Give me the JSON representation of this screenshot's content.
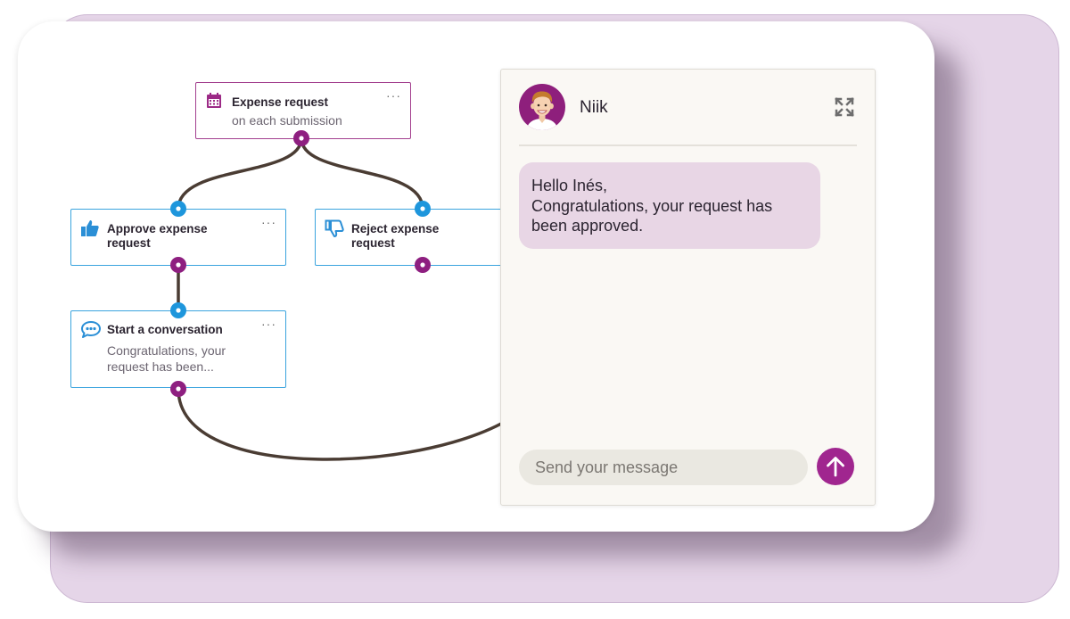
{
  "colors": {
    "accent": "#a0268f",
    "connector": "#4a3c33",
    "action_border": "#3aa4de",
    "trigger_border": "#a3408f",
    "bubble": "#e8d6e5",
    "panel": "#faf8f4"
  },
  "flow": {
    "trigger": {
      "icon": "calendar-icon",
      "title": "Expense request",
      "subtitle": "on each submission",
      "more": "···"
    },
    "approve": {
      "icon": "thumbs-up-icon",
      "title": "Approve expense request",
      "more": "···"
    },
    "reject": {
      "icon": "thumbs-down-icon",
      "title": "Reject expense request"
    },
    "conversation": {
      "icon": "chat-bubble-icon",
      "title": "Start a conversation",
      "subtitle": "Congratulations, your request has been...",
      "more": "···"
    }
  },
  "chat": {
    "name": "Niik",
    "avatar_icon": "user-avatar-icon",
    "expand_icon": "expand-icon",
    "message_lines": [
      "Hello Inés,",
      "Congratulations, your request has",
      "been approved."
    ],
    "input_placeholder": "Send your message",
    "send_icon": "arrow-up-icon"
  }
}
